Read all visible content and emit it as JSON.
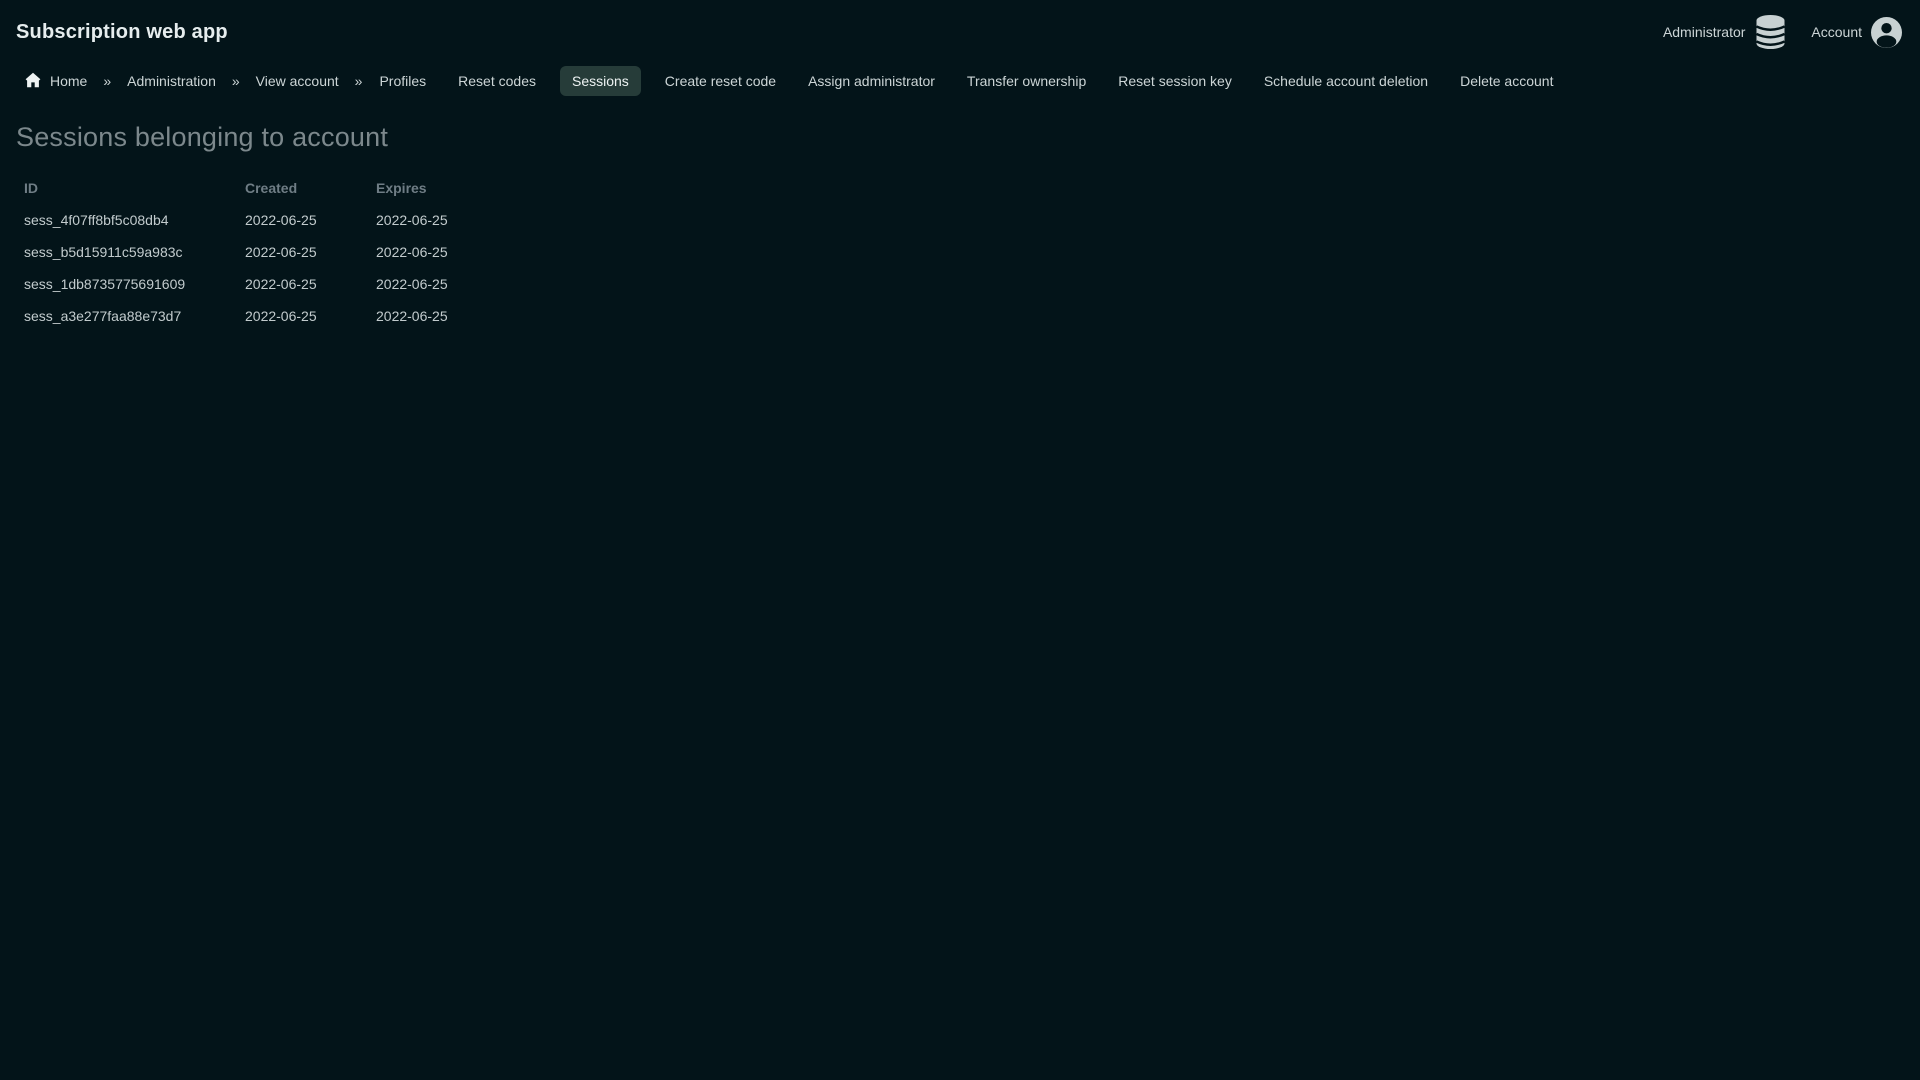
{
  "header": {
    "app_title": "Subscription web app",
    "admin_label": "Administrator",
    "account_label": "Account"
  },
  "nav": {
    "separator": "»",
    "breadcrumb": [
      {
        "label": "Home"
      },
      {
        "label": "Administration"
      },
      {
        "label": "View account"
      }
    ],
    "tabs": [
      "Profiles",
      "Reset codes",
      "Sessions",
      "Create reset code",
      "Assign administrator",
      "Transfer ownership",
      "Reset session key",
      "Schedule account deletion",
      "Delete account"
    ],
    "active_tab": "Sessions"
  },
  "main": {
    "heading": "Sessions belonging to account",
    "table": {
      "columns": [
        "ID",
        "Created",
        "Expires"
      ],
      "rows": [
        [
          "sess_4f07ff8bf5c08db4",
          "2022-06-25",
          "2022-06-25"
        ],
        [
          "sess_b5d15911c59a983c",
          "2022-06-25",
          "2022-06-25"
        ],
        [
          "sess_1db8735775691609",
          "2022-06-25",
          "2022-06-25"
        ],
        [
          "sess_a3e277faa88e73d7",
          "2022-06-25",
          "2022-06-25"
        ]
      ]
    }
  },
  "icons": {
    "home": "home-icon",
    "database": "database-icon",
    "account": "person-circle-icon"
  },
  "colors": {
    "background": "#031419",
    "active_tab_bg": "#263c39",
    "title_text": "#e6edee",
    "muted_text": "#7c888c",
    "table_header_text": "#6f7d85",
    "table_cell_text": "#c2cbcd",
    "icon_fill": "#c8d1d2"
  }
}
